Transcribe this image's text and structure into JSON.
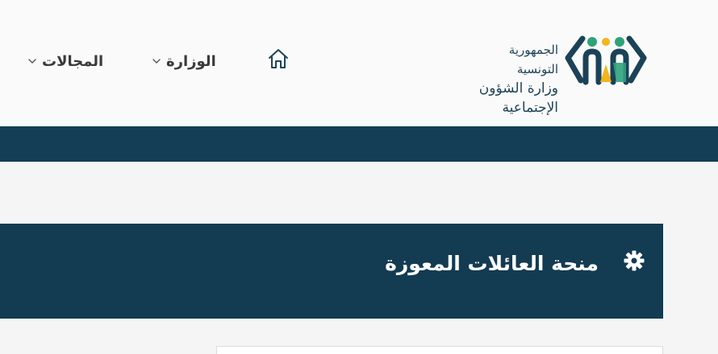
{
  "header": {
    "logo": {
      "line1": "الجمهورية التونسية",
      "line2": "وزارة الشؤون الإجتماعية",
      "colors": {
        "navy": "#1b4257",
        "green": "#2ea37b",
        "yellow": "#f2b51d"
      }
    },
    "nav": [
      {
        "label": "المجالات",
        "icon": "chevron-down-icon"
      },
      {
        "label": "الوزارة",
        "icon": "chevron-down-icon"
      }
    ],
    "home_icon": "home-icon"
  },
  "navbar": {
    "color": "#133e55"
  },
  "banner": {
    "title": "منحة العائلات المعوزة",
    "icon": "gear-icon",
    "color": "#133b52"
  }
}
